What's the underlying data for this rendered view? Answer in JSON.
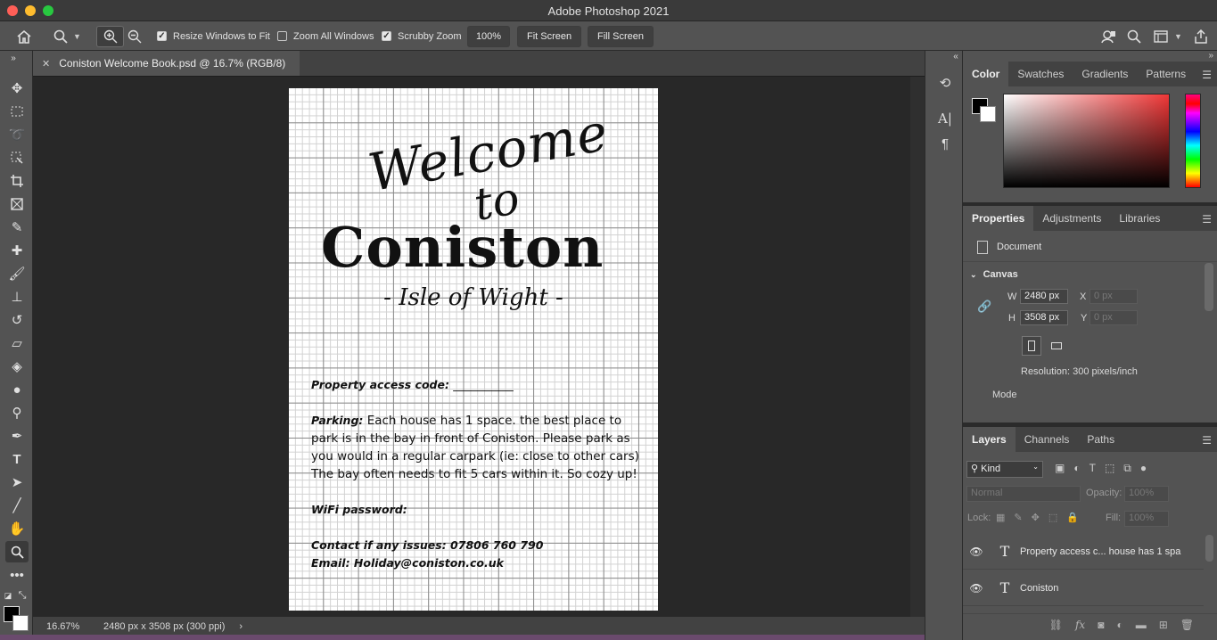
{
  "app": {
    "title": "Adobe Photoshop 2021"
  },
  "options": {
    "resize_label": "Resize Windows to Fit",
    "zoom_all_label": "Zoom All Windows",
    "scrubby_label": "Scrubby Zoom",
    "zoom_value": "100%",
    "fit_screen": "Fit Screen",
    "fill_screen": "Fill Screen"
  },
  "document": {
    "tab_title": "Coniston Welcome Book.psd @ 16.7% (RGB/8)",
    "zoom_status": "16.67%",
    "dims_status": "2480 px x 3508 px (300 ppi)",
    "content": {
      "welcome": "Welcome",
      "to": "to",
      "coniston": "Coniston",
      "isle": "- Isle of Wight -",
      "access_label": "Property access code:",
      "access_line": "__________",
      "parking_label": "Parking:",
      "parking_text": "Each house has 1 space. the best place to park is in the bay in front of Coniston. Please park as you would in a regular carpark (ie: close to other cars) The bay often needs to fit 5 cars within it. So cozy up!",
      "wifi": "WiFi password:",
      "contact": "Contact if any issues: 07806 760 790",
      "email": "Email: Holiday@coniston.co.uk"
    }
  },
  "panels": {
    "color_tabs": [
      "Color",
      "Swatches",
      "Gradients",
      "Patterns"
    ],
    "properties_tabs": [
      "Properties",
      "Adjustments",
      "Libraries"
    ],
    "doc_label": "Document",
    "canvas_label": "Canvas",
    "w_label": "W",
    "h_label": "H",
    "x_label": "X",
    "y_label": "Y",
    "w_value": "2480 px",
    "h_value": "3508 px",
    "x_placeholder": "0 px",
    "y_placeholder": "0 px",
    "resolution": "Resolution: 300 pixels/inch",
    "mode": "Mode",
    "layers_tabs": [
      "Layers",
      "Channels",
      "Paths"
    ],
    "kind": "Kind",
    "blend": "Normal",
    "opacity_label": "Opacity:",
    "opacity_value": "100%",
    "lock_label": "Lock:",
    "fill_label": "Fill:",
    "fill_value": "100%",
    "layers": [
      {
        "type": "T",
        "name": "Property access c... house has 1 spa"
      },
      {
        "type": "T",
        "name": "Coniston"
      }
    ]
  },
  "colors": {
    "foreground": "#000000",
    "background": "#ffffff"
  }
}
